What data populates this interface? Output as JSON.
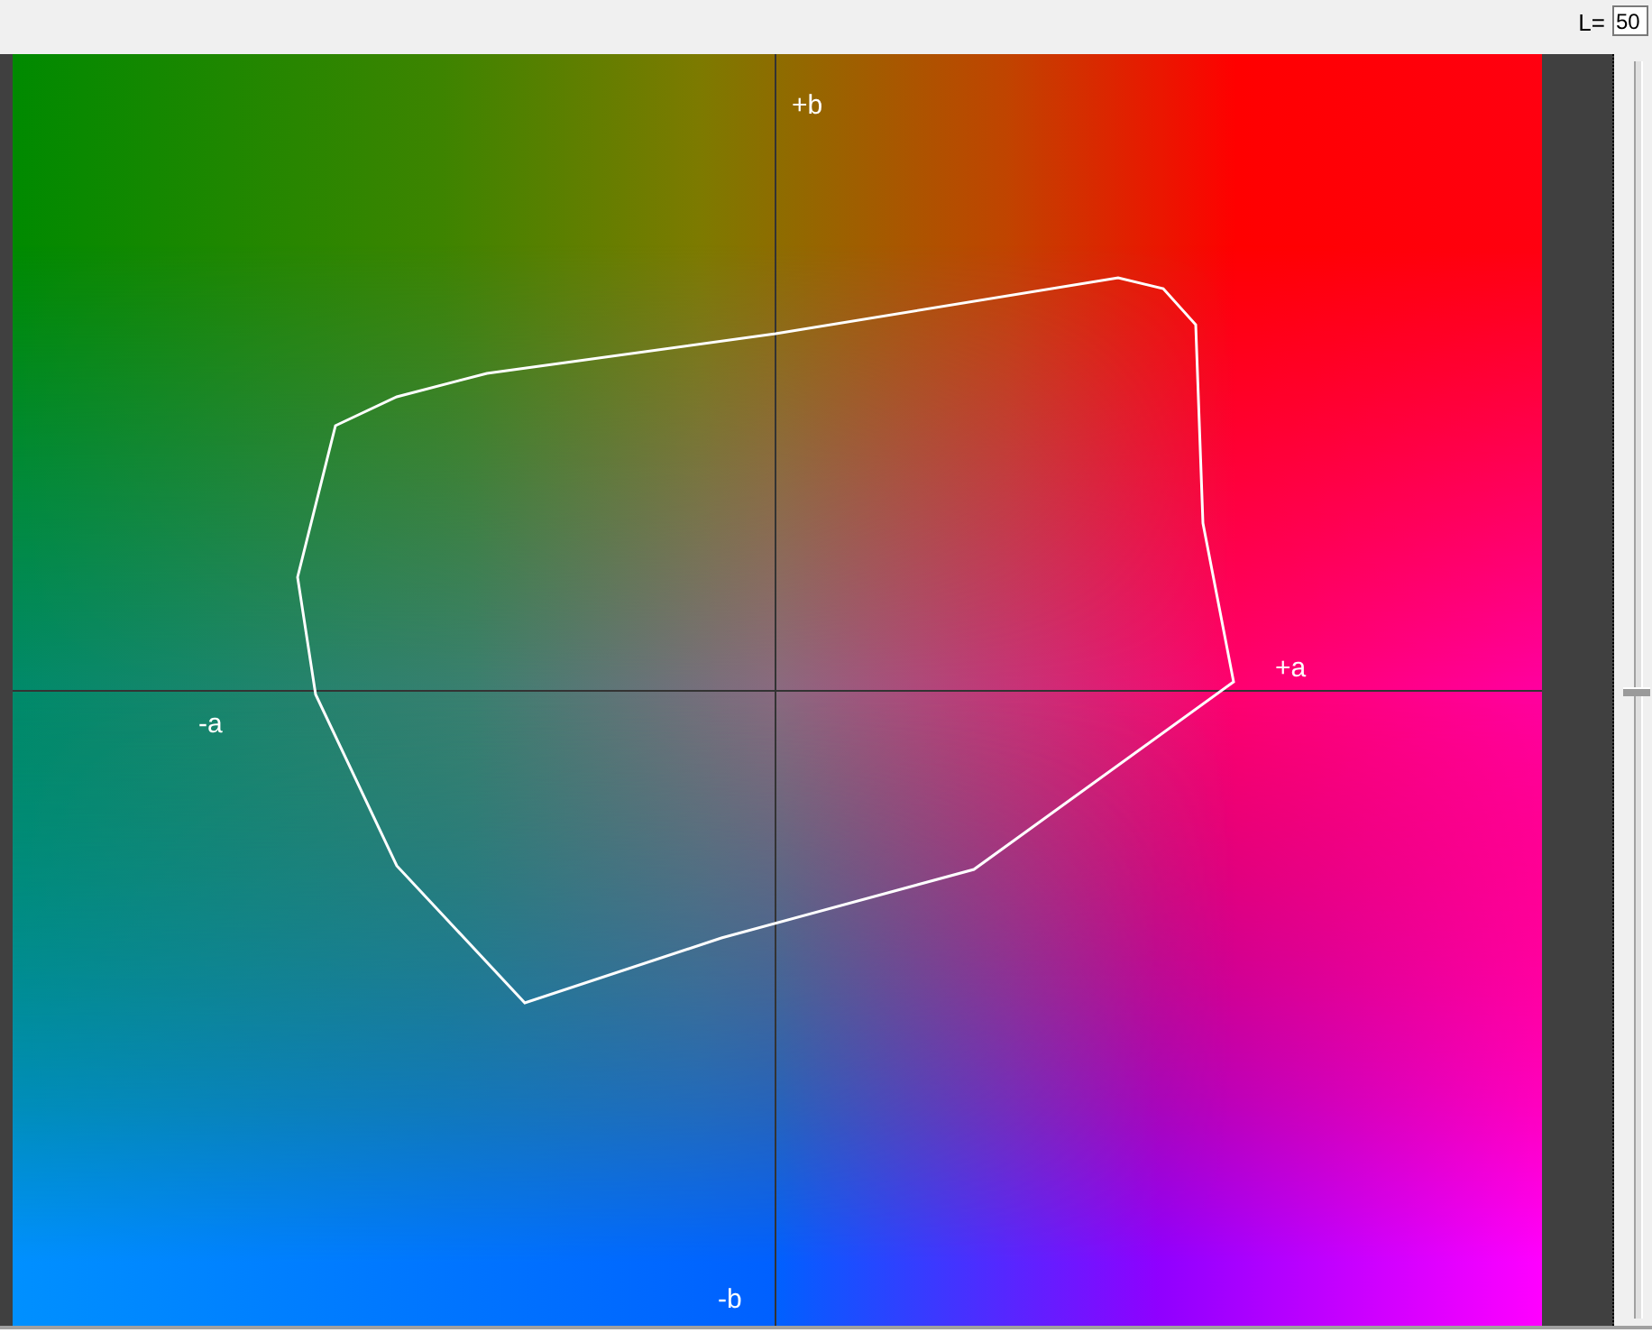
{
  "lightness": {
    "label": "L=",
    "value": "50"
  },
  "plot": {
    "axis_labels": [
      {
        "kind": "top",
        "text": "+b"
      },
      {
        "kind": "right",
        "text": "+a"
      },
      {
        "kind": "left",
        "text": "-a"
      },
      {
        "kind": "bottom",
        "text": "-b"
      }
    ]
  },
  "lightness_slider": {
    "level": 0.5
  }
}
